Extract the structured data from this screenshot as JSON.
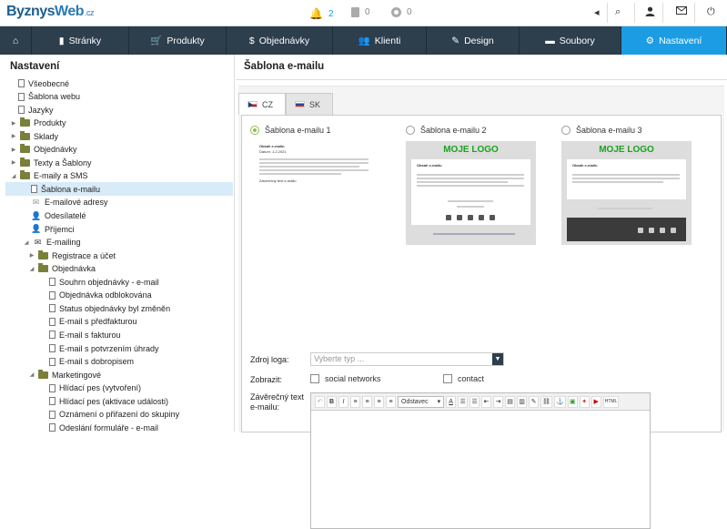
{
  "app": {
    "logo_main": "Byznys",
    "logo_accent": "Web",
    "logo_suffix": ".cz"
  },
  "topbar": {
    "notifications": "2",
    "cart": "0",
    "pending": "0"
  },
  "nav": [
    {
      "label": "",
      "icon": "home-icon",
      "active": false
    },
    {
      "label": "Stránky",
      "icon": "page-icon",
      "active": false
    },
    {
      "label": "Produkty",
      "icon": "cart-icon",
      "active": false
    },
    {
      "label": "Objednávky",
      "icon": "dollar-icon",
      "active": false
    },
    {
      "label": "Klienti",
      "icon": "users-icon",
      "active": false
    },
    {
      "label": "Design",
      "icon": "brush-icon",
      "active": false
    },
    {
      "label": "Soubory",
      "icon": "folder-icon",
      "active": false
    },
    {
      "label": "Nastavení",
      "icon": "gear-icon",
      "active": true
    }
  ],
  "sidebar": {
    "title": "Nastavení",
    "items": [
      {
        "label": "Všeobecné",
        "type": "doc",
        "level": 0
      },
      {
        "label": "Šablona webu",
        "type": "doc",
        "level": 0
      },
      {
        "label": "Jazyky",
        "type": "doc",
        "level": 0
      },
      {
        "label": "Produkty",
        "type": "folder",
        "level": 0,
        "arrow": "closed"
      },
      {
        "label": "Sklady",
        "type": "folder",
        "level": 0,
        "arrow": "closed"
      },
      {
        "label": "Objednávky",
        "type": "folder",
        "level": 0,
        "arrow": "closed"
      },
      {
        "label": "Texty a Šablony",
        "type": "folder",
        "level": 0,
        "arrow": "closed"
      },
      {
        "label": "E-maily a SMS",
        "type": "folder",
        "level": 0,
        "arrow": "open"
      },
      {
        "label": "Šablona e-mailu",
        "type": "doc",
        "level": 1,
        "selected": true
      },
      {
        "label": "E-mailové adresy",
        "type": "envelope",
        "level": 1
      },
      {
        "label": "Odesílatelé",
        "type": "user",
        "level": 1
      },
      {
        "label": "Příjemci",
        "type": "user",
        "level": 1
      },
      {
        "label": "E-mailing",
        "type": "mail",
        "level": 1,
        "arrow": "open"
      },
      {
        "label": "Registrace a účet",
        "type": "folder",
        "level": 2,
        "arrow": "closed"
      },
      {
        "label": "Objednávka",
        "type": "folder",
        "level": 2,
        "arrow": "open"
      },
      {
        "label": "Souhrn objednávky - e-mail",
        "type": "doc",
        "level": 3
      },
      {
        "label": "Objednávka odblokována",
        "type": "doc",
        "level": 3
      },
      {
        "label": "Status objednávky byl změněn",
        "type": "doc",
        "level": 3
      },
      {
        "label": "E-mail s předfakturou",
        "type": "doc",
        "level": 3
      },
      {
        "label": "E-mail s fakturou",
        "type": "doc",
        "level": 3
      },
      {
        "label": "E-mail s potvrzením úhrady",
        "type": "doc",
        "level": 3
      },
      {
        "label": "E-mail s dobropisem",
        "type": "doc",
        "level": 3
      },
      {
        "label": "Marketingové",
        "type": "folder",
        "level": 2,
        "arrow": "open"
      },
      {
        "label": "Hlídací pes (vytvoření)",
        "type": "doc",
        "level": 3
      },
      {
        "label": "Hlídací pes (aktivace události)",
        "type": "doc",
        "level": 3
      },
      {
        "label": "Oznámení o přiřazení do skupiny",
        "type": "doc",
        "level": 3
      },
      {
        "label": "Odeslání formuláře - e-mail",
        "type": "doc",
        "level": 3
      }
    ]
  },
  "main": {
    "title": "Šablona e-mailu",
    "tabs": [
      {
        "label": "CZ",
        "active": true
      },
      {
        "label": "SK",
        "active": false
      }
    ],
    "templates": [
      {
        "label": "Šablona e-mailu 1",
        "selected": true
      },
      {
        "label": "Šablona e-mailu 2",
        "selected": false,
        "logo": "MOJE LOGO"
      },
      {
        "label": "Šablona e-mailu 3",
        "selected": false,
        "logo": "MOJE LOGO"
      }
    ],
    "preview": {
      "heading": "Obsah e-mailu",
      "date": "Datum: 1.2.2021",
      "sign": "Záverečný text e-mailu"
    },
    "form": {
      "logo_label": "Zdroj loga:",
      "logo_placeholder": "Vyberte typ ...",
      "show_label": "Zobrazit:",
      "social_label": "social networks",
      "contact_label": "contact",
      "footer_label_1": "Závěrečný text",
      "footer_label_2": "e-mailu:"
    },
    "editor_toolbar": {
      "format": "Odstavec",
      "html": "HTML"
    }
  }
}
